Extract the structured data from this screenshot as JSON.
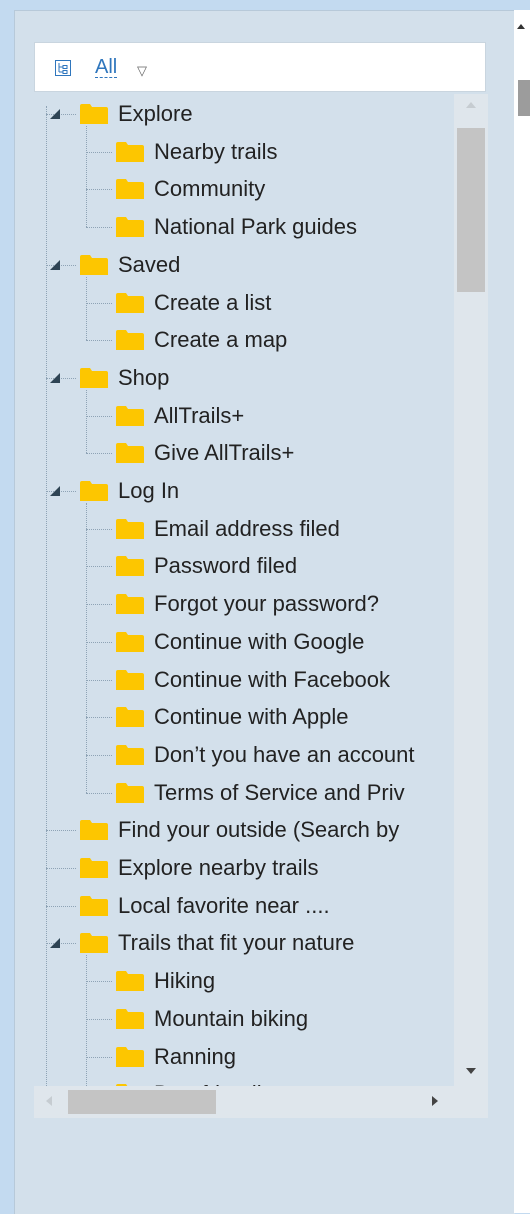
{
  "filter": {
    "label": "All",
    "icon": "tree-view-icon",
    "caret": "caret-down-icon"
  },
  "tree": {
    "rows": [
      {
        "label": "Explore",
        "level": 0,
        "expanded": true
      },
      {
        "label": "Nearby trails",
        "level": 1
      },
      {
        "label": "Community",
        "level": 1
      },
      {
        "label": "National Park guides",
        "level": 1
      },
      {
        "label": "Saved",
        "level": 0,
        "expanded": true
      },
      {
        "label": "Create a list",
        "level": 1
      },
      {
        "label": "Create a map",
        "level": 1
      },
      {
        "label": "Shop",
        "level": 0,
        "expanded": true
      },
      {
        "label": "AllTrails+",
        "level": 1
      },
      {
        "label": "Give AllTrails+",
        "level": 1
      },
      {
        "label": "Log In",
        "level": 0,
        "expanded": true
      },
      {
        "label": "Email address filed",
        "level": 1
      },
      {
        "label": "Password filed",
        "level": 1
      },
      {
        "label": "Forgot your password?",
        "level": 1
      },
      {
        "label": "Continue with Google",
        "level": 1
      },
      {
        "label": "Continue with Facebook",
        "level": 1
      },
      {
        "label": "Continue with Apple",
        "level": 1
      },
      {
        "label": "Don’t you have an account",
        "level": 1
      },
      {
        "label": "Terms of Service and Priv",
        "level": 1
      },
      {
        "label": "Find your outside (Search by",
        "level": 0
      },
      {
        "label": "Explore nearby trails",
        "level": 0
      },
      {
        "label": "Local favorite near ....",
        "level": 0
      },
      {
        "label": "Trails that fit your nature",
        "level": 0,
        "expanded": true
      },
      {
        "label": "Hiking",
        "level": 1
      },
      {
        "label": "Mountain biking",
        "level": 1
      },
      {
        "label": "Ranning",
        "level": 1
      },
      {
        "label": "Dog-friendly",
        "level": 1
      }
    ]
  },
  "colors": {
    "folder": "#fdc600",
    "accent": "#2f76bd",
    "arrow": "#2e4454"
  }
}
